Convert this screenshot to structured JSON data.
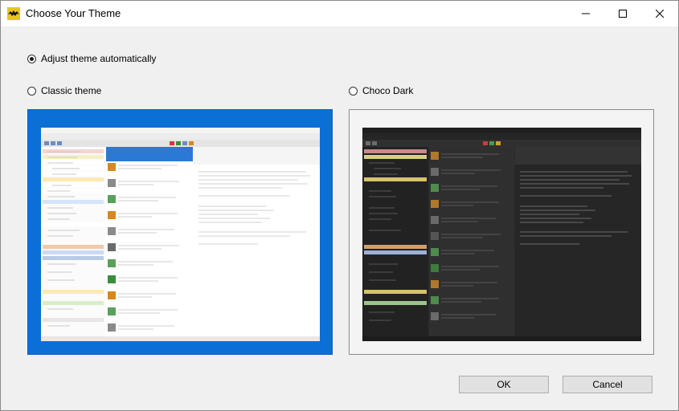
{
  "window": {
    "title": "Choose Your Theme",
    "controls": [
      "minimize-icon",
      "maximize-icon",
      "close-icon"
    ]
  },
  "options": {
    "auto": {
      "label": "Adjust theme automatically",
      "checked": true
    },
    "classic": {
      "label": "Classic theme",
      "checked": false
    },
    "dark": {
      "label": "Choco Dark",
      "checked": false
    }
  },
  "colors": {
    "classic_preview_bg": "#0b6fd6",
    "dark_preview_bg": "#2b2b2b",
    "dialog_bg": "#f0f0f0"
  },
  "buttons": {
    "ok": "OK",
    "cancel": "Cancel"
  }
}
